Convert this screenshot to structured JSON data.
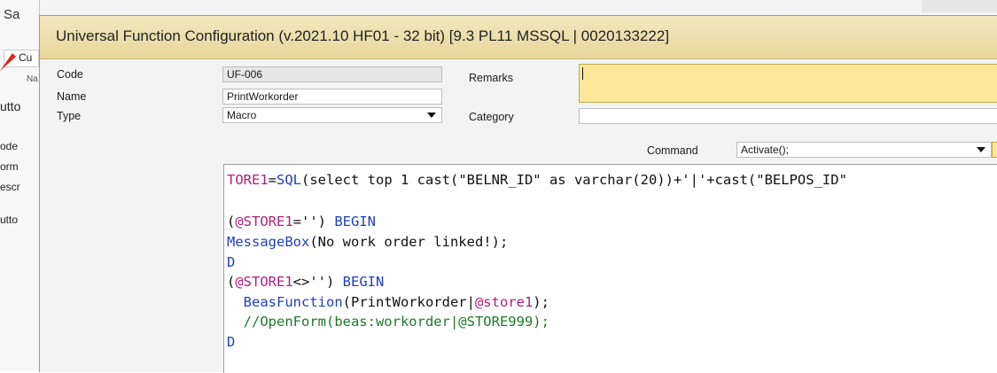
{
  "background": {
    "title": "Sa",
    "left_items": [
      "Cu",
      "Na",
      "utto",
      "ode",
      "orm",
      "escr",
      "utto"
    ]
  },
  "dialog": {
    "title": "Universal Function Configuration (v.2021.10 HF01 - 32 bit) [9.3 PL11 MSSQL | 0020133222]"
  },
  "form": {
    "code_label": "Code",
    "code_value": "UF-006",
    "name_label": "Name",
    "name_value": "PrintWorkorder",
    "type_label": "Type",
    "type_value": "Macro",
    "remarks_label": "Remarks",
    "remarks_value": "",
    "category_label": "Category",
    "category_value": "",
    "command_label": "Command",
    "command_value": "Activate();"
  },
  "editor": {
    "lines": [
      [
        {
          "t": "TORE1",
          "c": "v"
        },
        {
          "t": "=",
          "c": "m"
        },
        {
          "t": "SQL",
          "c": "k"
        },
        {
          "t": "(select top 1 cast(\"BELNR_ID\" as varchar(20))+'|'+cast(\"BELPOS_ID\"",
          "c": "m"
        }
      ],
      [],
      [
        {
          "t": "(",
          "c": "m"
        },
        {
          "t": "@STORE1",
          "c": "v"
        },
        {
          "t": "='') ",
          "c": "m"
        },
        {
          "t": "BEGIN",
          "c": "k"
        }
      ],
      [
        {
          "t": "MessageBox",
          "c": "k"
        },
        {
          "t": "(No work order linked!);",
          "c": "m"
        }
      ],
      [
        {
          "t": "D",
          "c": "k"
        }
      ],
      [
        {
          "t": "(",
          "c": "m"
        },
        {
          "t": "@STORE1",
          "c": "v"
        },
        {
          "t": "<>'') ",
          "c": "m"
        },
        {
          "t": "BEGIN",
          "c": "k"
        }
      ],
      [
        {
          "t": "  BeasFunction",
          "c": "k"
        },
        {
          "t": "(PrintWorkorder|",
          "c": "m"
        },
        {
          "t": "@store1",
          "c": "v"
        },
        {
          "t": ");",
          "c": "m"
        }
      ],
      [
        {
          "t": "  //OpenForm(beas:workorder|@STORE999);",
          "c": "c"
        }
      ],
      [
        {
          "t": "D",
          "c": "k"
        }
      ]
    ]
  },
  "colors": {
    "titlebar": "#e8d79b",
    "remarks_highlight": "#fbe79a",
    "keyword": "#1f3fbf",
    "variable": "#b0207a",
    "comment": "#1f7a2a",
    "annotation_arrow": "#e8201a"
  }
}
